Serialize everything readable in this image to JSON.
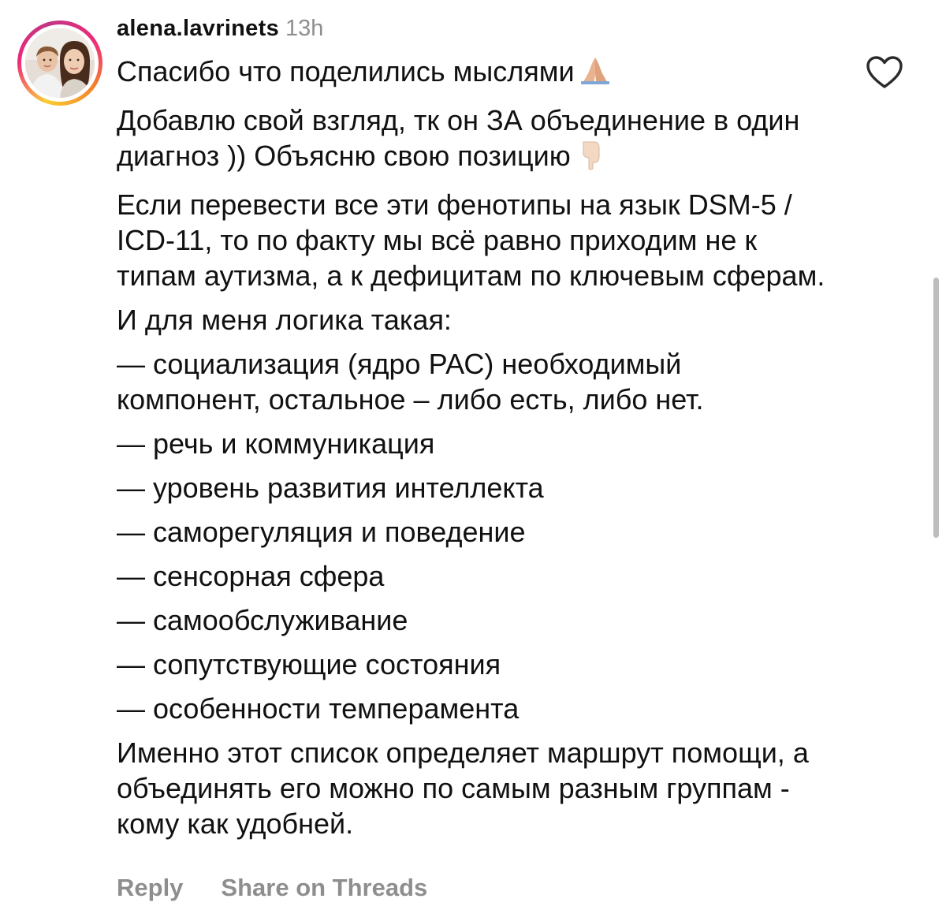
{
  "comment": {
    "username": "alena.lavrinets",
    "time": "13h",
    "avatar_icon": "profile-photo-avatar",
    "like_icon": "heart-outline-icon",
    "paragraphs": [
      "Спасибо что поделились мыслями",
      "Добавлю свой взгляд, тк он ЗА объединение в один диагноз )) Объясню свою позицию",
      "Если перевести все эти фенотипы на язык DSM-5 / ICD-11, то по факту мы всё равно приходим не к типам аутизма, а к дефицитам по ключевым сферам.",
      "И для меня логика такая:",
      "— социализация (ядро РАС) необходимый компонент, остальное – либо есть, либо нет.",
      "— речь и коммуникация",
      "— уровень развития интеллекта",
      "— саморегуляция и поведение",
      "— сенсорная сфера",
      "— самообслуживание",
      "— сопутствующие состояния",
      "— особенности темперамента",
      "Именно этот список определяет маршрут помощи, а объединять его можно по самым разным группам - кому как удобней."
    ],
    "emojis": {
      "praying_hands": "praying-hands-emoji",
      "pointing_down": "backhand-index-pointing-down-emoji"
    }
  },
  "actions": {
    "reply_label": "Reply",
    "share_label": "Share on Threads"
  },
  "colors": {
    "text": "#111111",
    "secondary": "#8e8e8e",
    "story_ring_start": "#f9ce34",
    "story_ring_mid": "#ee2a7b",
    "story_ring_end": "#c13584"
  }
}
